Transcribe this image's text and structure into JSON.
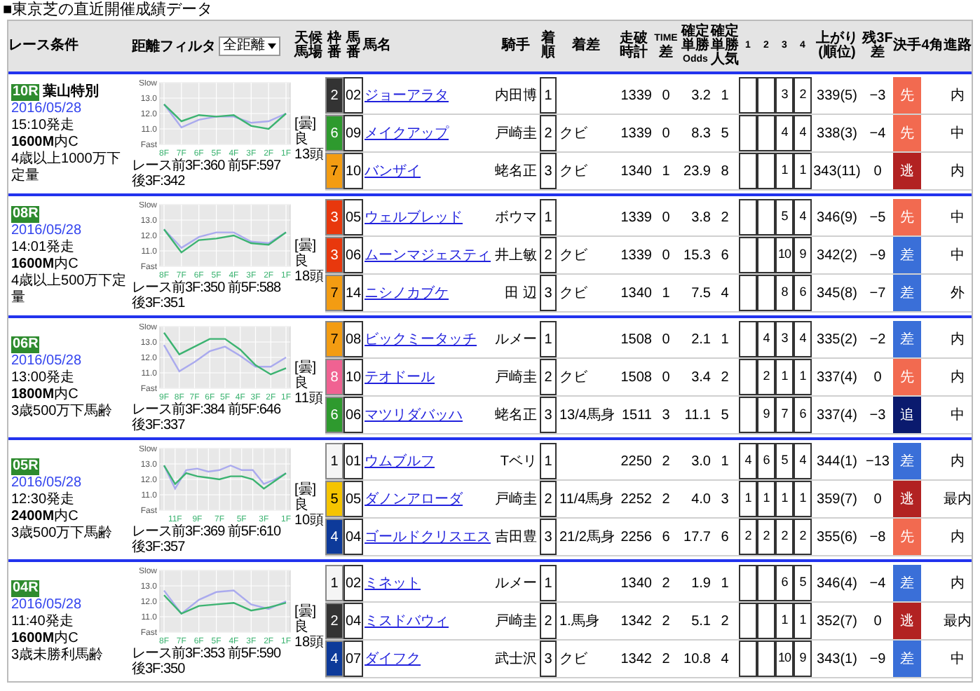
{
  "title": "■東京芝の直近開催成績データ",
  "header": {
    "race_label": "レース条件",
    "filter_label": "距離フィルタ",
    "filter_value": "全距離",
    "weather_label": "天候馬場",
    "columns": [
      "枠番",
      "馬番",
      "馬名",
      "騎手",
      "着順",
      "着差",
      "走破時計",
      "TIME\n差",
      "確定単勝\nOdds",
      "確定単勝人気",
      "1",
      "2",
      "3",
      "4",
      "上がり(順位)",
      "残3F\n差",
      "決手",
      "4角",
      "進路"
    ]
  },
  "races": [
    {
      "number": "10R",
      "name": "葉山特別",
      "date": "2016/05/28",
      "start": "15:10発走",
      "distance": "1600M",
      "course": "内C",
      "condition": "4歳以上1000万下定量",
      "splits": "レース前3F:360 前5F:597 後3F:342",
      "weather": "[曇]",
      "going": "良",
      "field": "13頭",
      "chart_data": {
        "type": "line",
        "x": [
          8,
          7,
          6,
          5,
          4,
          3,
          2,
          1
        ],
        "xlim": [
          8,
          1
        ],
        "grid": true,
        "xticks": [
          {
            "value": 8,
            "label": "8F"
          },
          {
            "value": 7,
            "label": "7F"
          },
          {
            "value": 6,
            "label": "6F"
          },
          {
            "value": 5,
            "label": "5F"
          },
          {
            "value": 4,
            "label": "4F"
          },
          {
            "value": 3,
            "label": "3F"
          },
          {
            "value": 2,
            "label": "2F"
          },
          {
            "value": 1,
            "label": "1F"
          }
        ],
        "ylim": [
          10,
          14
        ],
        "yticks": [
          {
            "value": 14,
            "label": "Slow"
          },
          {
            "value": 13,
            "label": "13.0"
          },
          {
            "value": 12,
            "label": "12.0"
          },
          {
            "value": 11,
            "label": "11.0"
          },
          {
            "value": 10,
            "label": "Fast"
          }
        ],
        "series": [
          {
            "color": "#aaaaee",
            "values": [
              12.6,
              11.1,
              11.6,
              11.8,
              11.8,
              11.4,
              11.5,
              12.0
            ]
          },
          {
            "color": "#3cb371",
            "values": [
              12.6,
              11.5,
              11.9,
              11.8,
              11.9,
              11.2,
              11.0,
              12.0
            ]
          }
        ]
      },
      "horses": [
        {
          "frame": {
            "number": "2",
            "color": "#333333"
          },
          "number": "02",
          "name": "ジョーアラタ",
          "jockey": "内田博",
          "place": "1",
          "time": "1339",
          "time_diff": "0",
          "odds": "3.2",
          "popularity": "1",
          "passing": {
            "c3": "3",
            "c4": "2"
          },
          "last3f": "339(5)",
          "diff3f": "−3",
          "style": {
            "label": "先",
            "color": "#f26a50"
          },
          "route": "内"
        },
        {
          "frame": {
            "number": "6",
            "color": "#2e9a2e"
          },
          "number": "09",
          "name": "メイクアップ",
          "jockey": "戸崎圭",
          "place": "2",
          "margin": "クビ",
          "time": "1339",
          "time_diff": "0",
          "odds": "8.3",
          "popularity": "5",
          "passing": {
            "c3": "4",
            "c4": "4"
          },
          "last3f": "338(3)",
          "diff3f": "−4",
          "style": {
            "label": "先",
            "color": "#f26a50"
          },
          "route": "中"
        },
        {
          "frame": {
            "number": "7",
            "color": "#f39c12"
          },
          "number": "10",
          "name": "バンザイ",
          "jockey": "蛯名正",
          "place": "3",
          "margin": "クビ",
          "time": "1340",
          "time_diff": "1",
          "odds": "23.9",
          "popularity": "8",
          "passing": {
            "c3": "1",
            "c4": "1"
          },
          "last3f": "343(11)",
          "diff3f": "0",
          "style": {
            "label": "逃",
            "color": "#b22222"
          },
          "route": "内"
        }
      ]
    },
    {
      "number": "08R",
      "date": "2016/05/28",
      "start": "14:01発走",
      "distance": "1600M",
      "course": "内C",
      "condition": "4歳以上500万下定量",
      "splits": "レース前3F:350 前5F:588 後3F:351",
      "weather": "[曇]",
      "going": "良",
      "field": "18頭",
      "chart_data": {
        "type": "line",
        "x": [
          8,
          7,
          6,
          5,
          4,
          3,
          2,
          1
        ],
        "xlim": [
          8,
          1
        ],
        "grid": true,
        "xticks": [
          {
            "value": 8,
            "label": "8F"
          },
          {
            "value": 7,
            "label": "7F"
          },
          {
            "value": 6,
            "label": "6F"
          },
          {
            "value": 5,
            "label": "5F"
          },
          {
            "value": 4,
            "label": "4F"
          },
          {
            "value": 3,
            "label": "3F"
          },
          {
            "value": 2,
            "label": "2F"
          },
          {
            "value": 1,
            "label": "1F"
          }
        ],
        "ylim": [
          10,
          14
        ],
        "yticks": [
          {
            "value": 14,
            "label": "Slow"
          },
          {
            "value": 13,
            "label": "13.0"
          },
          {
            "value": 12,
            "label": "12.0"
          },
          {
            "value": 11,
            "label": "11.0"
          },
          {
            "value": 10,
            "label": "Fast"
          }
        ],
        "series": [
          {
            "color": "#aaaaee",
            "values": [
              12.4,
              11.2,
              11.9,
              12.2,
              12.2,
              11.6,
              11.5,
              12.2
            ]
          },
          {
            "color": "#3cb371",
            "values": [
              12.4,
              10.9,
              11.7,
              11.8,
              12.0,
              11.5,
              11.4,
              12.2
            ]
          }
        ]
      },
      "horses": [
        {
          "frame": {
            "number": "3",
            "color": "#e8380d"
          },
          "number": "05",
          "name": "ウェルブレッド",
          "jockey": "ボウマ",
          "place": "1",
          "time": "1339",
          "time_diff": "0",
          "odds": "3.8",
          "popularity": "2",
          "passing": {
            "c3": "5",
            "c4": "4"
          },
          "last3f": "346(9)",
          "diff3f": "−5",
          "style": {
            "label": "先",
            "color": "#f26a50"
          },
          "route": "中"
        },
        {
          "frame": {
            "number": "3",
            "color": "#e8380d"
          },
          "number": "06",
          "name": "ムーンマジェスティ",
          "jockey": "井上敏",
          "place": "2",
          "margin": "クビ",
          "time": "1339",
          "time_diff": "0",
          "odds": "15.3",
          "popularity": "6",
          "passing": {
            "c3": "10",
            "c4": "9"
          },
          "last3f": "342(2)",
          "diff3f": "−9",
          "style": {
            "label": "差",
            "color": "#3a6fd8"
          },
          "route": "中"
        },
        {
          "frame": {
            "number": "7",
            "color": "#f39c12"
          },
          "number": "14",
          "name": "ニシノカブケ",
          "jockey": "田 辺",
          "place": "3",
          "margin": "クビ",
          "time": "1340",
          "time_diff": "1",
          "odds": "7.5",
          "popularity": "4",
          "passing": {
            "c3": "8",
            "c4": "6"
          },
          "last3f": "345(8)",
          "diff3f": "−7",
          "style": {
            "label": "差",
            "color": "#3a6fd8"
          },
          "route": "外"
        }
      ]
    },
    {
      "number": "06R",
      "date": "2016/05/28",
      "start": "13:00発走",
      "distance": "1800M",
      "course": "内C",
      "condition": "3歳500万下馬齢",
      "splits": "レース前3F:384 前5F:646 後3F:337",
      "weather": "[曇]",
      "going": "良",
      "field": "11頭",
      "chart_data": {
        "type": "line",
        "x": [
          9,
          8,
          7,
          6,
          5,
          4,
          3,
          2,
          1
        ],
        "xlim": [
          9,
          1
        ],
        "grid": true,
        "xticks": [
          {
            "value": 9,
            "label": "9F"
          },
          {
            "value": 8,
            "label": "8F"
          },
          {
            "value": 7,
            "label": "7F"
          },
          {
            "value": 6,
            "label": "6F"
          },
          {
            "value": 5,
            "label": "5F"
          },
          {
            "value": 4,
            "label": "4F"
          },
          {
            "value": 3,
            "label": "3F"
          },
          {
            "value": 2,
            "label": "2F"
          },
          {
            "value": 1,
            "label": "1F"
          }
        ],
        "ylim": [
          10,
          14
        ],
        "yticks": [
          {
            "value": 14,
            "label": "Slow"
          },
          {
            "value": 13,
            "label": "13.0"
          },
          {
            "value": 12,
            "label": "12.0"
          },
          {
            "value": 11,
            "label": "11.0"
          },
          {
            "value": 10,
            "label": "Fast"
          }
        ],
        "series": [
          {
            "color": "#aaaaee",
            "values": [
              12.8,
              11.1,
              11.7,
              12.4,
              12.7,
              12.1,
              11.4,
              11.4,
              12.0
            ]
          },
          {
            "color": "#3cb371",
            "values": [
              13.6,
              12.2,
              12.7,
              13.2,
              13.2,
              12.5,
              11.5,
              10.9,
              11.3
            ]
          }
        ]
      },
      "horses": [
        {
          "frame": {
            "number": "7",
            "color": "#f39c12"
          },
          "number": "08",
          "name": "ビックミータッチ",
          "jockey": "ルメー",
          "place": "1",
          "time": "1508",
          "time_diff": "0",
          "odds": "2.1",
          "popularity": "1",
          "passing": {
            "c2": "4",
            "c3": "3",
            "c4": "4"
          },
          "last3f": "335(2)",
          "diff3f": "−2",
          "style": {
            "label": "差",
            "color": "#3a6fd8"
          },
          "route": "内"
        },
        {
          "frame": {
            "number": "8",
            "color": "#f06292"
          },
          "number": "10",
          "name": "テオドール",
          "jockey": "戸崎圭",
          "place": "2",
          "margin": "クビ",
          "time": "1508",
          "time_diff": "0",
          "odds": "3.4",
          "popularity": "2",
          "passing": {
            "c2": "2",
            "c3": "1",
            "c4": "1"
          },
          "last3f": "337(4)",
          "diff3f": "0",
          "style": {
            "label": "先",
            "color": "#f26a50"
          },
          "route": "内"
        },
        {
          "frame": {
            "number": "6",
            "color": "#2e9a2e"
          },
          "number": "06",
          "name": "マツリダバッハ",
          "jockey": "蛯名正",
          "place": "3",
          "margin": "13/4馬身",
          "time": "1511",
          "time_diff": "3",
          "odds": "11.1",
          "popularity": "5",
          "passing": {
            "c2": "9",
            "c3": "7",
            "c4": "6"
          },
          "last3f": "337(4)",
          "diff3f": "−3",
          "style": {
            "label": "追",
            "color": "#0a1a6e"
          },
          "route": "中"
        }
      ]
    },
    {
      "number": "05R",
      "date": "2016/05/28",
      "start": "12:30発走",
      "distance": "2400M",
      "course": "内C",
      "condition": "3歳500万下馬齢",
      "splits": "レース前3F:369 前5F:610 後3F:357",
      "weather": "[曇]",
      "going": "良",
      "field": "10頭",
      "chart_data": {
        "type": "line",
        "x": [
          12,
          11,
          10,
          9,
          8,
          7,
          6,
          5,
          4,
          3,
          2,
          1
        ],
        "xlim": [
          12,
          1
        ],
        "grid": true,
        "xticks": [
          {
            "value": 11,
            "label": "11F"
          },
          {
            "value": 9,
            "label": "9F"
          },
          {
            "value": 7,
            "label": "7F"
          },
          {
            "value": 5,
            "label": "5F"
          },
          {
            "value": 3,
            "label": "3F"
          },
          {
            "value": 1,
            "label": "1F"
          }
        ],
        "ylim": [
          10,
          14
        ],
        "yticks": [
          {
            "value": 14,
            "label": "Slow"
          },
          {
            "value": 13,
            "label": "13.0"
          },
          {
            "value": 12,
            "label": "12.0"
          },
          {
            "value": 11,
            "label": "11.0"
          },
          {
            "value": 10,
            "label": "Fast"
          }
        ],
        "series": [
          {
            "color": "#aaaaee",
            "values": [
              12.9,
              11.4,
              12.6,
              12.7,
              12.5,
              12.6,
              12.9,
              12.6,
              12.6,
              11.7,
              12.0,
              12.4
            ]
          },
          {
            "color": "#3cb371",
            "values": [
              12.9,
              11.7,
              12.4,
              12.2,
              12.1,
              12.0,
              12.2,
              12.2,
              12.0,
              11.4,
              11.9,
              12.4
            ]
          }
        ]
      },
      "horses": [
        {
          "frame": {
            "number": "1",
            "color": "#f5f5f5"
          },
          "number": "01",
          "name": "ウムブルフ",
          "jockey": "Tベリ",
          "place": "1",
          "time": "2250",
          "time_diff": "2",
          "odds": "3.0",
          "popularity": "1",
          "passing": {
            "c1": "4",
            "c2": "6",
            "c3": "5",
            "c4": "4"
          },
          "last3f": "344(1)",
          "diff3f": "−13",
          "style": {
            "label": "差",
            "color": "#3a6fd8"
          },
          "route": "内"
        },
        {
          "frame": {
            "number": "5",
            "color": "#f5c400"
          },
          "number": "05",
          "name": "ダノンアローダ",
          "jockey": "戸崎圭",
          "place": "2",
          "margin": "11/4馬身",
          "time": "2252",
          "time_diff": "2",
          "odds": "4.0",
          "popularity": "3",
          "passing": {
            "c1": "1",
            "c2": "1",
            "c3": "1",
            "c4": "1"
          },
          "last3f": "359(7)",
          "diff3f": "0",
          "style": {
            "label": "逃",
            "color": "#b22222"
          },
          "route": "最内"
        },
        {
          "frame": {
            "number": "4",
            "color": "#0d3a9a"
          },
          "number": "04",
          "name": "ゴールドクリスエス",
          "jockey": "吉田豊",
          "place": "3",
          "margin": "21/2馬身",
          "time": "2256",
          "time_diff": "6",
          "odds": "17.7",
          "popularity": "6",
          "passing": {
            "c1": "2",
            "c2": "2",
            "c3": "2",
            "c4": "2"
          },
          "last3f": "355(6)",
          "diff3f": "−8",
          "style": {
            "label": "先",
            "color": "#f26a50"
          },
          "route": "内"
        }
      ]
    },
    {
      "number": "04R",
      "date": "2016/05/28",
      "start": "11:40発走",
      "distance": "1600M",
      "course": "内C",
      "condition": "3歳未勝利馬齢",
      "splits": "レース前3F:353 前5F:590 後3F:350",
      "weather": "[曇]",
      "going": "良",
      "field": "18頭",
      "chart_data": {
        "type": "line",
        "x": [
          8,
          7,
          6,
          5,
          4,
          3,
          2,
          1
        ],
        "xlim": [
          8,
          1
        ],
        "grid": true,
        "xticks": [
          {
            "value": 8,
            "label": "8F"
          },
          {
            "value": 7,
            "label": "7F"
          },
          {
            "value": 6,
            "label": "6F"
          },
          {
            "value": 5,
            "label": "5F"
          },
          {
            "value": 4,
            "label": "4F"
          },
          {
            "value": 3,
            "label": "3F"
          },
          {
            "value": 2,
            "label": "2F"
          },
          {
            "value": 1,
            "label": "1F"
          }
        ],
        "ylim": [
          10,
          14
        ],
        "yticks": [
          {
            "value": 14,
            "label": "Slow"
          },
          {
            "value": 13,
            "label": "13.0"
          },
          {
            "value": 12,
            "label": "12.0"
          },
          {
            "value": 11,
            "label": "11.0"
          },
          {
            "value": 10,
            "label": "Fast"
          }
        ],
        "series": [
          {
            "color": "#aaaaee",
            "values": [
              12.7,
              11.2,
              12.1,
              12.6,
              12.7,
              11.8,
              11.5,
              12.0
            ]
          },
          {
            "color": "#3cb371",
            "values": [
              12.4,
              11.2,
              11.7,
              11.8,
              11.9,
              11.4,
              11.6,
              11.9
            ]
          }
        ]
      },
      "horses": [
        {
          "frame": {
            "number": "1",
            "color": "#f5f5f5"
          },
          "number": "02",
          "name": "ミネット",
          "jockey": "ルメー",
          "place": "1",
          "time": "1340",
          "time_diff": "2",
          "odds": "1.9",
          "popularity": "1",
          "passing": {
            "c3": "6",
            "c4": "5"
          },
          "last3f": "346(4)",
          "diff3f": "−4",
          "style": {
            "label": "差",
            "color": "#3a6fd8"
          },
          "route": "内"
        },
        {
          "frame": {
            "number": "2",
            "color": "#333333"
          },
          "number": "04",
          "name": "ミスドバウィ",
          "jockey": "戸崎圭",
          "place": "2",
          "margin": "1.馬身",
          "time": "1342",
          "time_diff": "2",
          "odds": "5.1",
          "popularity": "2",
          "passing": {
            "c3": "1",
            "c4": "1"
          },
          "last3f": "352(7)",
          "diff3f": "0",
          "style": {
            "label": "逃",
            "color": "#b22222"
          },
          "route": "最内"
        },
        {
          "frame": {
            "number": "4",
            "color": "#0d3a9a"
          },
          "number": "07",
          "name": "ダイフク",
          "jockey": "武士沢",
          "place": "3",
          "margin": "クビ",
          "time": "1342",
          "time_diff": "2",
          "odds": "10.8",
          "popularity": "4",
          "passing": {
            "c3": "10",
            "c4": "9"
          },
          "last3f": "343(1)",
          "diff3f": "−9",
          "style": {
            "label": "差",
            "color": "#3a6fd8"
          },
          "route": "中"
        }
      ]
    }
  ]
}
